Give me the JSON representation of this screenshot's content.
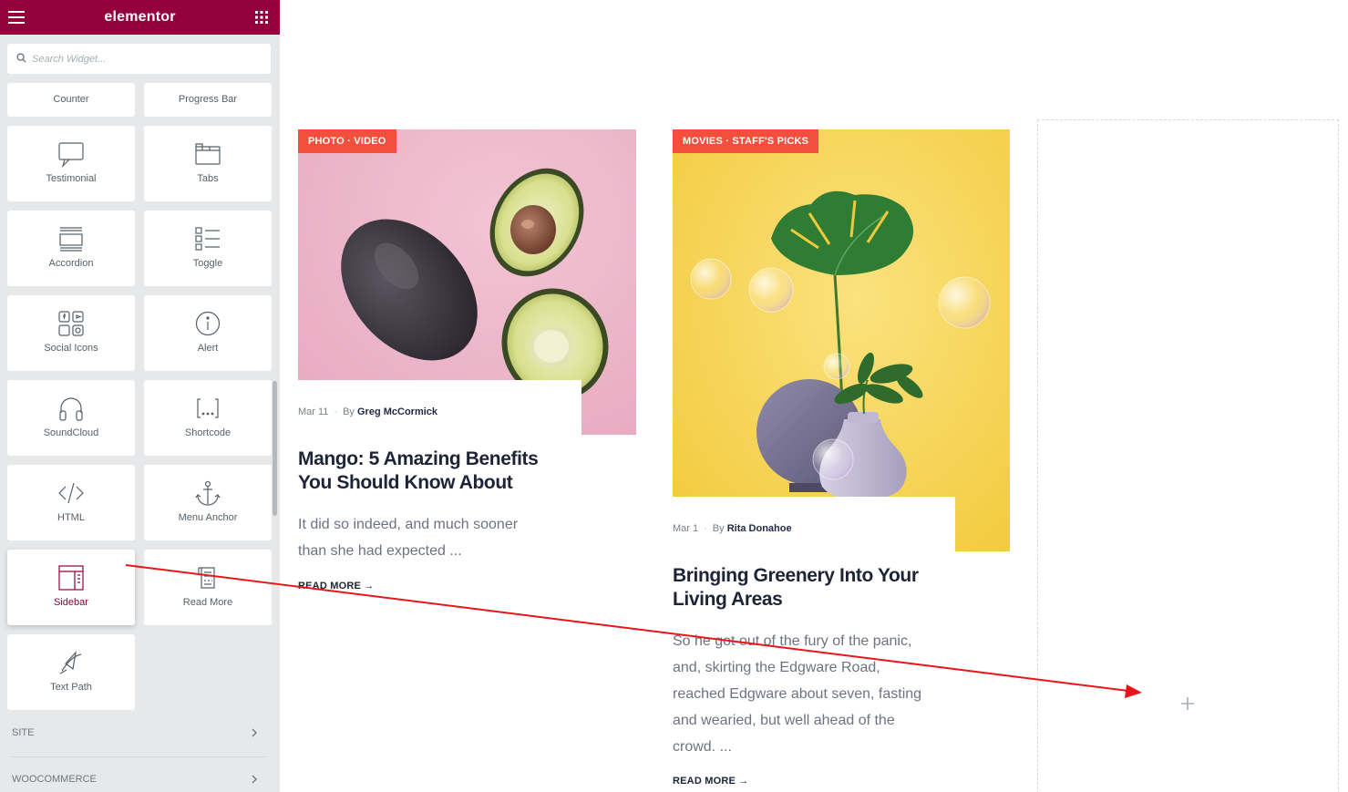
{
  "editor": {
    "brand": "elementor",
    "search": {
      "placeholder": "Search Widget..."
    },
    "widgets": [
      {
        "label": "Counter",
        "icon": "counter-icon"
      },
      {
        "label": "Progress Bar",
        "icon": "progress-bar-icon"
      },
      {
        "label": "Testimonial",
        "icon": "speech-bubble-icon"
      },
      {
        "label": "Tabs",
        "icon": "tabs-icon"
      },
      {
        "label": "Accordion",
        "icon": "accordion-icon"
      },
      {
        "label": "Toggle",
        "icon": "toggle-list-icon"
      },
      {
        "label": "Social Icons",
        "icon": "social-icons-icon"
      },
      {
        "label": "Alert",
        "icon": "info-circle-icon"
      },
      {
        "label": "SoundCloud",
        "icon": "headphones-icon"
      },
      {
        "label": "Shortcode",
        "icon": "shortcode-brackets-icon"
      },
      {
        "label": "HTML",
        "icon": "code-icon"
      },
      {
        "label": "Menu Anchor",
        "icon": "anchor-icon"
      },
      {
        "label": "Sidebar",
        "icon": "sidebar-layout-icon",
        "active": true
      },
      {
        "label": "Read More",
        "icon": "read-more-document-icon"
      },
      {
        "label": "Text Path",
        "icon": "text-path-icon"
      }
    ],
    "categories": [
      {
        "label": "SITE"
      },
      {
        "label": "WOOCOMMERCE"
      }
    ]
  },
  "posts": [
    {
      "badge": "PHOTO · VIDEO",
      "date": "Mar 11",
      "by": "By",
      "author": "Greg McCormick",
      "title": "Mango: 5 Amazing Benefits You Should Know About",
      "excerpt": "It did so indeed, and much sooner than she had expected ...",
      "read_more": "READ MORE →"
    },
    {
      "badge": "MOVIES · STAFF'S PICKS",
      "date": "Mar 1",
      "by": "By",
      "author": "Rita Donahoe",
      "title": "Bringing Greenery Into Your Living Areas",
      "excerpt": "So he got out of the fury of the panic, and, skirting the Edgware Road, reached Edgware about seven, fasting and wearied, but well ahead of the crowd. ...",
      "read_more": "READ MORE →"
    }
  ],
  "colors": {
    "brand": "#93003c",
    "badge": "#f24f3d",
    "drag_arrow": "#e8161b"
  }
}
